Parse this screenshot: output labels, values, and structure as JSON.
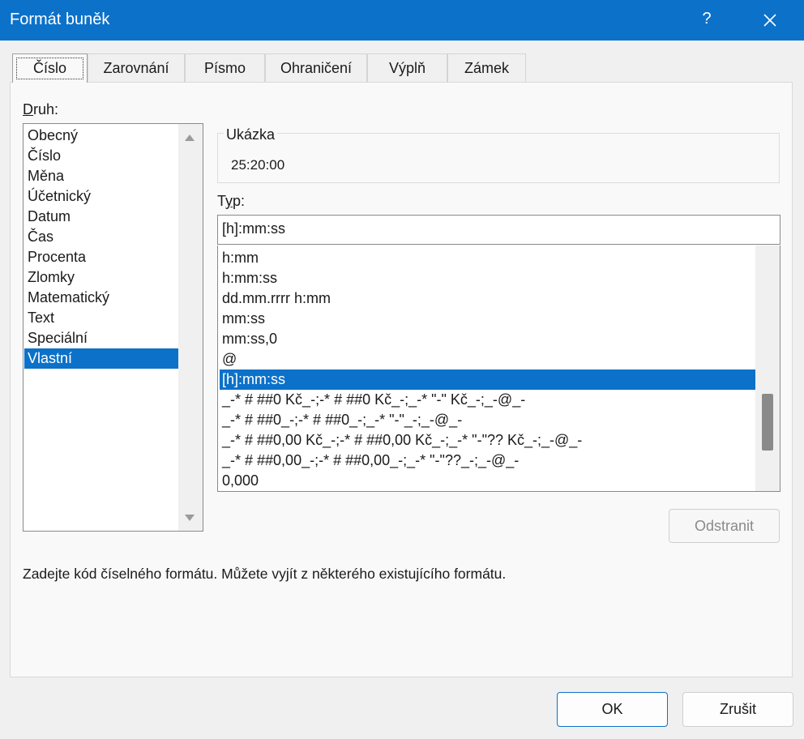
{
  "window": {
    "title": "Formát buněk",
    "help_label": "?"
  },
  "tabs": [
    {
      "label": "Číslo"
    },
    {
      "label": "Zarovnání"
    },
    {
      "label": "Písmo"
    },
    {
      "label": "Ohraničení"
    },
    {
      "label": "Výplň"
    },
    {
      "label": "Zámek"
    }
  ],
  "category": {
    "label": "Druh:",
    "items": [
      "Obecný",
      "Číslo",
      "Měna",
      "Účetnický",
      "Datum",
      "Čas",
      "Procenta",
      "Zlomky",
      "Matematický",
      "Text",
      "Speciální",
      "Vlastní"
    ],
    "selected": "Vlastní"
  },
  "sample": {
    "legend": "Ukázka",
    "value": "25:20:00"
  },
  "type": {
    "label": "Typ:",
    "value": "[h]:mm:ss",
    "formats": [
      "h:mm",
      "h:mm:ss",
      "dd.mm.rrrr h:mm",
      "mm:ss",
      "mm:ss,0",
      "@",
      "[h]:mm:ss",
      "_-* # ##0 Kč_-;-* # ##0 Kč_-;_-* \"-\" Kč_-;_-@_-",
      "_-* # ##0_-;-* # ##0_-;_-* \"-\"_-;_-@_-",
      "_-* # ##0,00 Kč_-;-* # ##0,00 Kč_-;_-* \"-\"?? Kč_-;_-@_-",
      "_-* # ##0,00_-;-* # ##0,00_-;_-* \"-\"??_-;_-@_-",
      "0,000"
    ],
    "selected": "[h]:mm:ss"
  },
  "buttons": {
    "delete": "Odstranit",
    "ok": "OK",
    "cancel": "Zrušit"
  },
  "hint": "Zadejte kód číselného formátu. Můžete vyjít z některého existujícího formátu.",
  "colors": {
    "accent": "#0c71c9"
  }
}
